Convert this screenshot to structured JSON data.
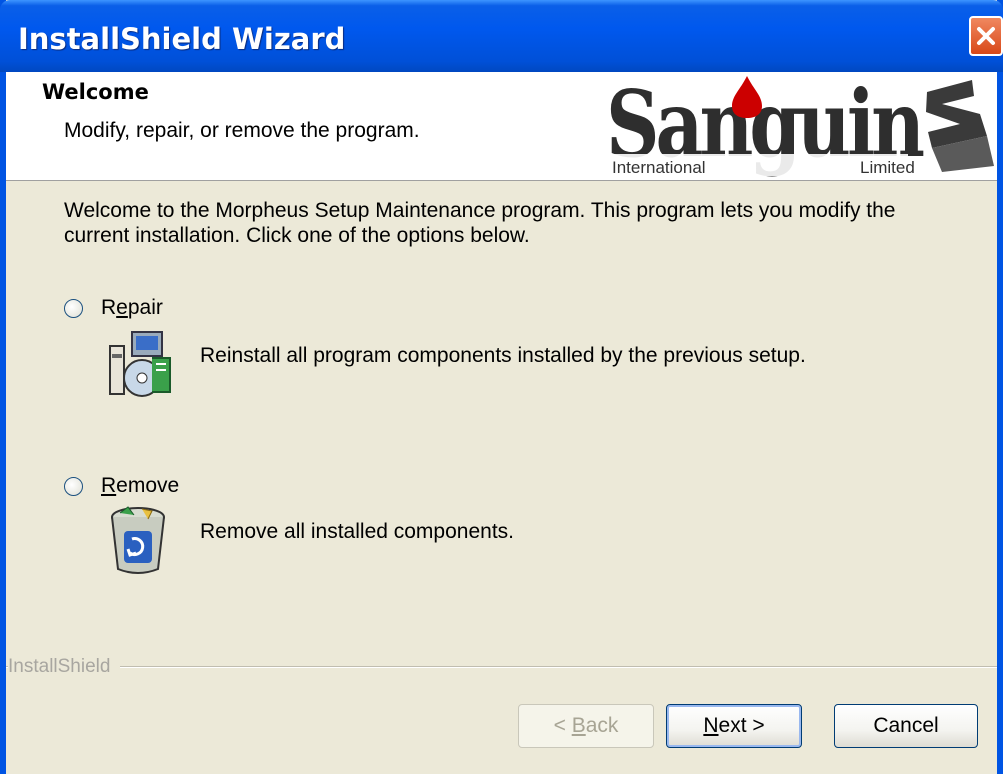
{
  "window": {
    "title": "InstallShield Wizard"
  },
  "header": {
    "title": "Welcome",
    "subtitle": "Modify, repair, or remove the program.",
    "logo": {
      "name": "Sanguin",
      "left": "International",
      "right": "Limited"
    }
  },
  "intro": "Welcome to the Morpheus Setup Maintenance program. This program lets you modify the current installation. Click one of the options below.",
  "options": [
    {
      "label_pre": "R",
      "label_u": "e",
      "label_post": "pair",
      "description": "Reinstall all program components installed by the previous setup.",
      "icon": "repair-icon",
      "selected": false
    },
    {
      "label_pre": "",
      "label_u": "R",
      "label_post": "emove",
      "description": "Remove all installed components.",
      "icon": "recycle-bin-icon",
      "selected": false
    }
  ],
  "brand": "InstallShield",
  "buttons": {
    "back": {
      "pre": "< ",
      "u": "B",
      "post": "ack",
      "enabled": false
    },
    "next": {
      "pre": "",
      "u": "N",
      "post": "ext >",
      "enabled": true
    },
    "cancel": {
      "label": "Cancel",
      "enabled": true
    }
  },
  "colors": {
    "titlebar": "#0054e3",
    "dialog_bg": "#ece9d8",
    "logo_drop": "#cc0000"
  }
}
